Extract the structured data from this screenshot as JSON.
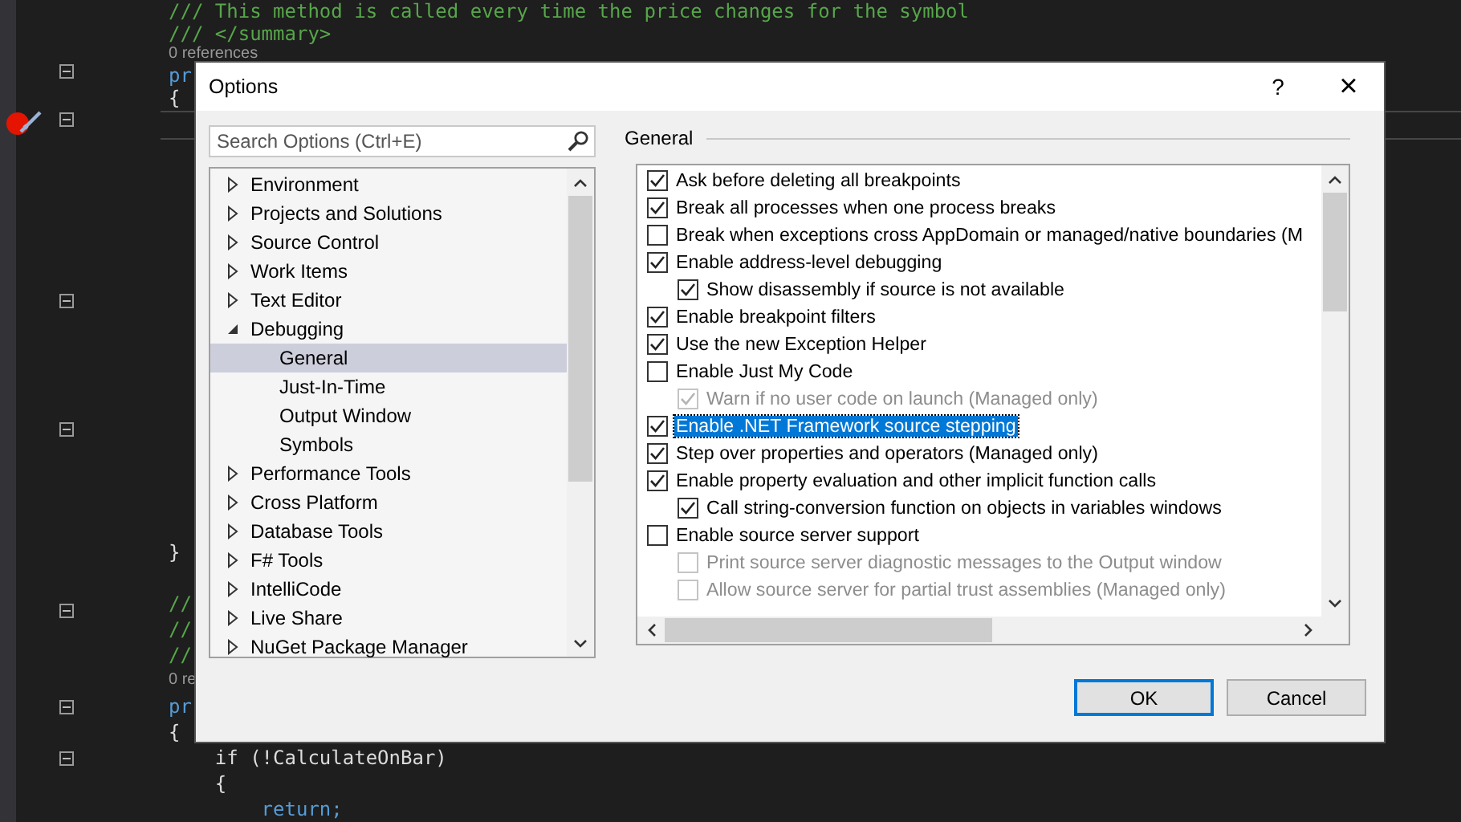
{
  "editor": {
    "code_top": [
      {
        "kind": "comment",
        "text": "/// This method is called every time the price changes for the symbol"
      },
      {
        "kind": "comment",
        "text": "/// </summary>"
      },
      {
        "kind": "ref",
        "text": "0 references"
      },
      {
        "kind": "keyword",
        "text": "pr"
      },
      {
        "kind": "code",
        "text": "{"
      }
    ],
    "code_bottom": [
      {
        "kind": "code",
        "text": "}"
      },
      {
        "kind": "comment",
        "text": "//"
      },
      {
        "kind": "comment",
        "text": "//"
      },
      {
        "kind": "comment",
        "text": "//"
      },
      {
        "kind": "ref",
        "text": "0 re"
      },
      {
        "kind": "keyword",
        "text": "pr"
      },
      {
        "kind": "code",
        "text": "{"
      },
      {
        "kind": "code",
        "text": "    if (!CalculateOnBar)"
      },
      {
        "kind": "code",
        "text": "    {"
      },
      {
        "kind": "keyword",
        "text": "        return;"
      }
    ]
  },
  "dialog": {
    "title": "Options",
    "help": "?",
    "close": "×",
    "search": {
      "placeholder": "Search Options (Ctrl+E)"
    },
    "tree": [
      {
        "label": "Environment",
        "expanded": false,
        "selected": false
      },
      {
        "label": "Projects and Solutions",
        "expanded": false,
        "selected": false
      },
      {
        "label": "Source Control",
        "expanded": false,
        "selected": false
      },
      {
        "label": "Work Items",
        "expanded": false,
        "selected": false
      },
      {
        "label": "Text Editor",
        "expanded": false,
        "selected": false
      },
      {
        "label": "Debugging",
        "expanded": true,
        "selected": false,
        "children": [
          {
            "label": "General",
            "selected": true
          },
          {
            "label": "Just-In-Time",
            "selected": false
          },
          {
            "label": "Output Window",
            "selected": false
          },
          {
            "label": "Symbols",
            "selected": false
          }
        ]
      },
      {
        "label": "Performance Tools",
        "expanded": false,
        "selected": false
      },
      {
        "label": "Cross Platform",
        "expanded": false,
        "selected": false
      },
      {
        "label": "Database Tools",
        "expanded": false,
        "selected": false
      },
      {
        "label": "F# Tools",
        "expanded": false,
        "selected": false
      },
      {
        "label": "IntelliCode",
        "expanded": false,
        "selected": false
      },
      {
        "label": "Live Share",
        "expanded": false,
        "selected": false
      },
      {
        "label": "NuGet Package Manager",
        "expanded": false,
        "selected": false
      }
    ],
    "section_title": "General",
    "options": [
      {
        "label": "Ask before deleting all breakpoints",
        "checked": true,
        "disabled": false,
        "selected": false
      },
      {
        "label": "Break all processes when one process breaks",
        "checked": true,
        "disabled": false,
        "selected": false
      },
      {
        "label": "Break when exceptions cross AppDomain or managed/native boundaries (M",
        "checked": false,
        "disabled": false,
        "selected": false
      },
      {
        "label": "Enable address-level debugging",
        "checked": true,
        "disabled": false,
        "selected": false,
        "children": [
          {
            "label": "Show disassembly if source is not available",
            "checked": true,
            "disabled": false,
            "selected": false
          }
        ]
      },
      {
        "label": "Enable breakpoint filters",
        "checked": true,
        "disabled": false,
        "selected": false
      },
      {
        "label": "Use the new Exception Helper",
        "checked": true,
        "disabled": false,
        "selected": false
      },
      {
        "label": "Enable Just My Code",
        "checked": false,
        "disabled": false,
        "selected": false,
        "children": [
          {
            "label": "Warn if no user code on launch (Managed only)",
            "checked": true,
            "disabled": true,
            "selected": false
          }
        ]
      },
      {
        "label": "Enable .NET Framework source stepping",
        "checked": true,
        "disabled": false,
        "selected": true
      },
      {
        "label": "Step over properties and operators (Managed only)",
        "checked": true,
        "disabled": false,
        "selected": false
      },
      {
        "label": "Enable property evaluation and other implicit function calls",
        "checked": true,
        "disabled": false,
        "selected": false,
        "children": [
          {
            "label": "Call string-conversion function on objects in variables windows",
            "checked": true,
            "disabled": false,
            "selected": false
          }
        ]
      },
      {
        "label": "Enable source server support",
        "checked": false,
        "disabled": false,
        "selected": false,
        "children": [
          {
            "label": "Print source server diagnostic messages to the Output window",
            "checked": false,
            "disabled": true,
            "selected": false
          },
          {
            "label": "Allow source server for partial trust assemblies (Managed only)",
            "checked": false,
            "disabled": true,
            "selected": false
          }
        ]
      }
    ],
    "buttons": [
      {
        "label": "OK",
        "kind": "default"
      },
      {
        "label": "Cancel",
        "kind": "normal"
      }
    ]
  }
}
